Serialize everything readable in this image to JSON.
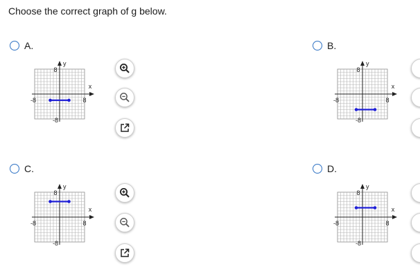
{
  "question": "Choose the correct graph of g below.",
  "options": [
    {
      "letter": "A.",
      "segment": {
        "x": [
          -3,
          3
        ],
        "y": -2
      }
    },
    {
      "letter": "B.",
      "segment": {
        "x": [
          -2,
          4
        ],
        "y": -5
      }
    },
    {
      "letter": "C.",
      "segment": {
        "x": [
          -3,
          3
        ],
        "y": 5
      }
    },
    {
      "letter": "D.",
      "segment": {
        "x": [
          -2,
          4
        ],
        "y": 3
      }
    }
  ],
  "graph": {
    "x_label": "x",
    "y_label": "y",
    "x_min_label": "-8",
    "x_max_label": "8",
    "y_max_label": "8",
    "y_min_label": "-8",
    "xlim": [
      -8,
      8
    ],
    "ylim": [
      -8,
      8
    ],
    "grid_step": 1,
    "segment_color": "#1f1fd6"
  },
  "tools": [
    "zoom-in-icon",
    "zoom-out-icon",
    "popout-icon"
  ],
  "accent_color": "#2f72c4"
}
